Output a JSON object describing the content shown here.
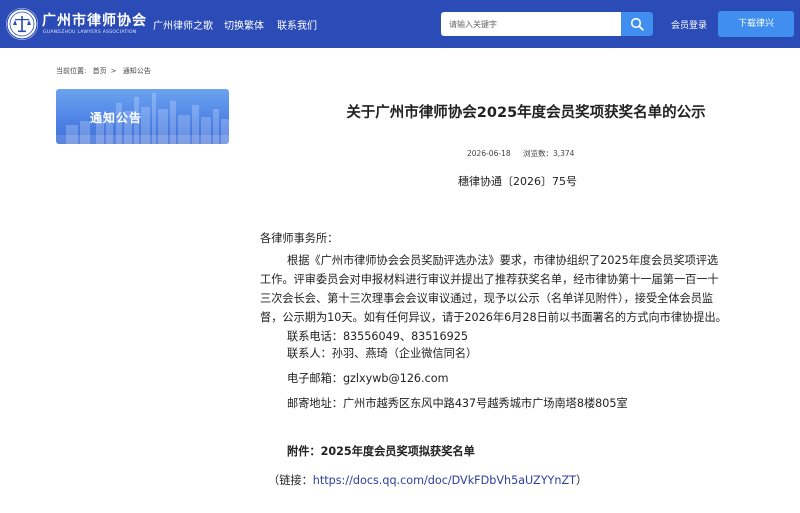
{
  "header": {
    "brand_name": "广州市律师协会",
    "brand_sub": "GUANGZHOU LAWYERS ASSOCIATION",
    "nav": [
      {
        "label": "广州律师之歌"
      },
      {
        "label": "切换繁体"
      },
      {
        "label": "联系我们"
      }
    ],
    "search_placeholder": "请输入关键字",
    "login_label": "会员登录",
    "download_label": "下载律兴",
    "colors": {
      "header_bg": "#2b4bb6",
      "accent": "#3f8ef0"
    }
  },
  "breadcrumb": {
    "prefix": "当前位置:",
    "home": "首页",
    "sep": ">",
    "current": "通知公告"
  },
  "sidebar": {
    "banner_title": "通知公告"
  },
  "article": {
    "title": "关于广州市律师协会2025年度会员奖项获奖名单的公示",
    "date": "2026-06-18",
    "views": "浏览数：3,374",
    "doc_no": "穗律协通〔2026〕75号",
    "greeting": "各律师事务所：",
    "body_lines": [
      "根据《广州市律师协会会员奖励评选办法》要求，市律协组织了2025年度会员奖项评选",
      "工作。评审委员会对申报材料进行审议并提出了推荐获奖名单，经市律协第十一届第一百一十",
      "三次会长会、第十三次理事会会议审议通过，现予以公示（名单详见附件），接受全体会员监",
      "督，公示期为10天。如有任何异议，请于2026年6月28日前以书面署名的方式向市律协提出。"
    ],
    "phone": "联系电话：83556049、83516925",
    "contact": "联系人：孙羽、燕琦（企业微信同名）",
    "email": "电子邮箱：gzlxywb@126.com",
    "address": "邮寄地址：广州市越秀区东风中路437号越秀城市广场南塔8楼805室",
    "attachment": "附件：2025年度会员奖项拟获奖名单",
    "link_prefix": "（链接：",
    "link_url": "https://docs.qq.com/doc/DVkFDbVh5aUZYYnZT",
    "link_suffix": "）"
  }
}
